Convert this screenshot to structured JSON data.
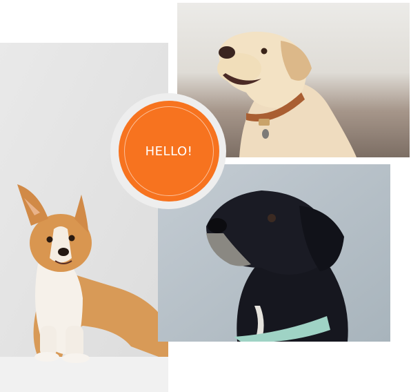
{
  "badge": {
    "text": "HELLO!",
    "color": "#f7731f"
  },
  "photos": [
    {
      "subject": "corgi",
      "background": "#eaeaea"
    },
    {
      "subject": "yellow-labrador",
      "background": "#d9d7d2"
    },
    {
      "subject": "black-labrador",
      "background": "#b7c3cb"
    }
  ]
}
